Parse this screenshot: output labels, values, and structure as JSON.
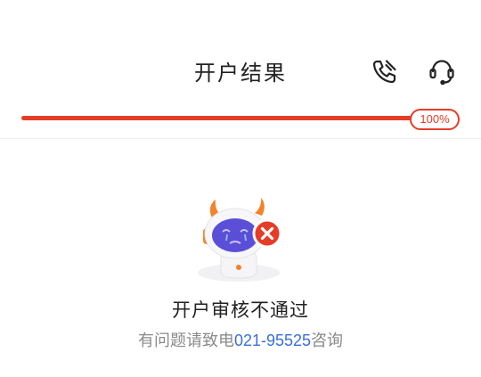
{
  "header": {
    "title": "开户结果",
    "actions": [
      {
        "icon": "phone-icon"
      },
      {
        "icon": "headset-icon"
      }
    ]
  },
  "progress": {
    "value": 100,
    "label": "100%",
    "color": "#e53d27"
  },
  "result": {
    "status": "failed",
    "title": "开户审核不通过",
    "hint_prefix": "有问题请致电",
    "hotline": "021-95525",
    "hint_suffix": "咨询"
  },
  "colors": {
    "accent": "#e53d27",
    "link": "#3a6fdc",
    "mascot_purple": "#5a4fd6"
  }
}
